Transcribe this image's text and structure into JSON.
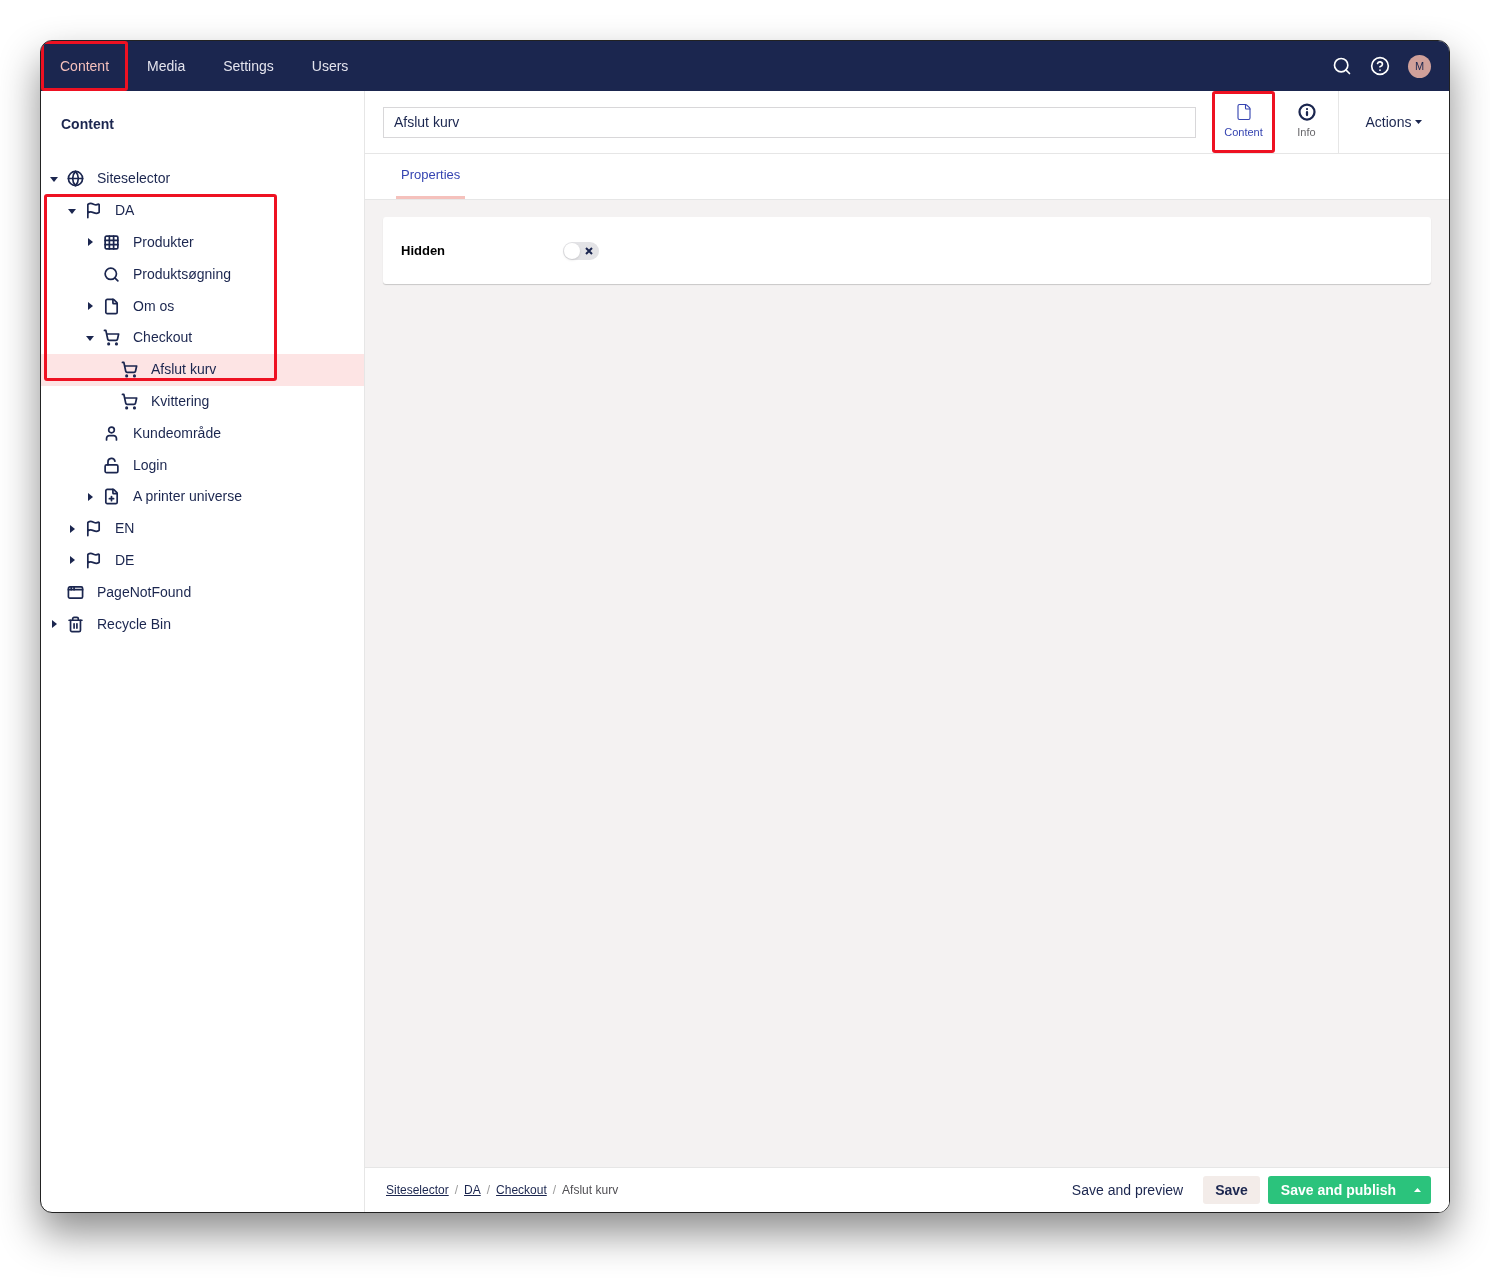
{
  "top_nav": {
    "sections": [
      {
        "label": "Content",
        "selected": true,
        "highlighted": true
      },
      {
        "label": "Media",
        "selected": false,
        "highlighted": false
      },
      {
        "label": "Settings",
        "selected": false,
        "highlighted": false
      },
      {
        "label": "Users",
        "selected": false,
        "highlighted": false
      }
    ],
    "avatar_initial": "M"
  },
  "sidebar": {
    "title": "Content",
    "tree": [
      {
        "label": "Siteselector",
        "expanded": true,
        "selected": false,
        "children": [
          {
            "label": "DA",
            "expanded": true,
            "selected": false,
            "highlighted": true,
            "children": [
              {
                "label": "Produkter",
                "expanded": false,
                "selected": false
              },
              {
                "label": "Produktsøgning",
                "selected": false
              },
              {
                "label": "Om os",
                "expanded": false,
                "selected": false
              },
              {
                "label": "Checkout",
                "expanded": true,
                "selected": false,
                "children": [
                  {
                    "label": "Afslut kurv",
                    "selected": true
                  },
                  {
                    "label": "Kvittering",
                    "selected": false
                  }
                ]
              },
              {
                "label": "Kundeområde",
                "selected": false
              },
              {
                "label": "Login",
                "selected": false
              },
              {
                "label": "A printer universe",
                "expanded": false,
                "selected": false
              }
            ]
          },
          {
            "label": "EN",
            "expanded": false,
            "selected": false
          },
          {
            "label": "DE",
            "expanded": false,
            "selected": false
          }
        ]
      },
      {
        "label": "PageNotFound",
        "selected": false
      },
      {
        "label": "Recycle Bin",
        "expanded": false,
        "selected": false
      }
    ]
  },
  "editor": {
    "name": "Afslut kurv",
    "apps": [
      {
        "label": "Content",
        "selected": true,
        "highlighted": true
      },
      {
        "label": "Info",
        "selected": false,
        "highlighted": false
      }
    ],
    "actions": "Actions",
    "tabs": [
      {
        "label": "Properties",
        "selected": true
      }
    ],
    "properties": [
      {
        "label": "Hidden",
        "kind": "toggle",
        "on": false
      }
    ],
    "breadcrumbs": [
      "Siteselector",
      "DA",
      "Checkout",
      "Afslut kurv"
    ],
    "breadcrumb_separator": "/",
    "buttons": {
      "preview": "Save and preview",
      "save": "Save",
      "publish": "Save and publish"
    }
  }
}
